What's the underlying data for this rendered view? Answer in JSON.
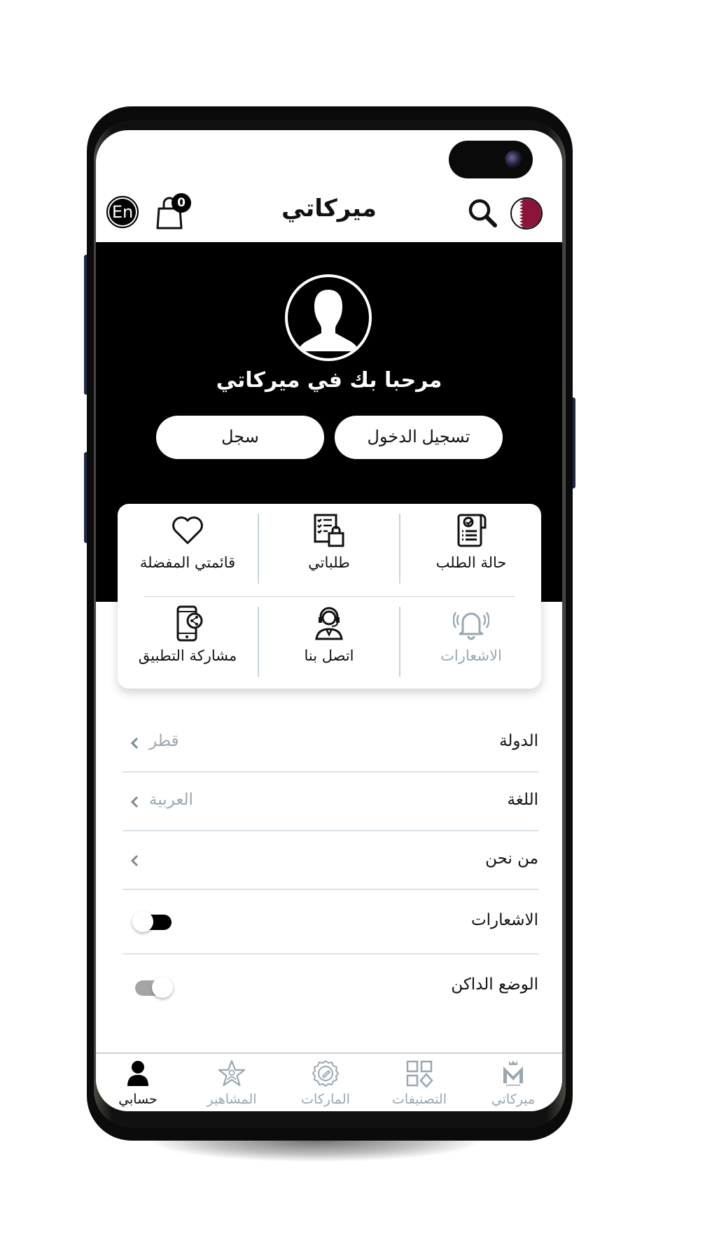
{
  "app": {
    "title": "ميركاتي",
    "language_button": "En",
    "cart_count": "0",
    "country_flag": "qatar-flag"
  },
  "hero": {
    "welcome": "مرحبا بك في ميركاتي",
    "login_label": "تسجيل الدخول",
    "register_label": "سجل"
  },
  "quick_actions": [
    {
      "label": "حالة الطلب",
      "icon": "order-status-icon",
      "enabled": true
    },
    {
      "label": "طلباتي",
      "icon": "my-orders-icon",
      "enabled": true
    },
    {
      "label": "قائمتي المفضلة",
      "icon": "heart-icon",
      "enabled": true
    },
    {
      "label": "الاشعارات",
      "icon": "bell-icon",
      "enabled": false
    },
    {
      "label": "اتصل بنا",
      "icon": "support-agent-icon",
      "enabled": true
    },
    {
      "label": "مشاركة التطبيق",
      "icon": "share-app-icon",
      "enabled": true
    }
  ],
  "settings": [
    {
      "label": "الدولة",
      "value": "قطر",
      "type": "link"
    },
    {
      "label": "اللغة",
      "value": "العربية",
      "type": "link"
    },
    {
      "label": "من نحن",
      "value": "",
      "type": "link"
    },
    {
      "label": "الاشعارات",
      "type": "toggle",
      "on": true
    },
    {
      "label": "الوضع الداكن",
      "type": "toggle",
      "on": false
    }
  ],
  "bottom_nav": [
    {
      "label": "ميركاتي",
      "icon": "mercati-logo-icon",
      "active": false
    },
    {
      "label": "التصنيفات",
      "icon": "categories-icon",
      "active": false
    },
    {
      "label": "الماركات",
      "icon": "brands-badge-icon",
      "active": false
    },
    {
      "label": "المشاهير",
      "icon": "celebrities-star-icon",
      "active": false
    },
    {
      "label": "حسابي",
      "icon": "account-icon",
      "active": true
    }
  ],
  "colors": {
    "primary": "#000000",
    "muted": "#9aa7b0",
    "divider": "#c9d3db",
    "qatar_maroon": "#8a1538"
  }
}
